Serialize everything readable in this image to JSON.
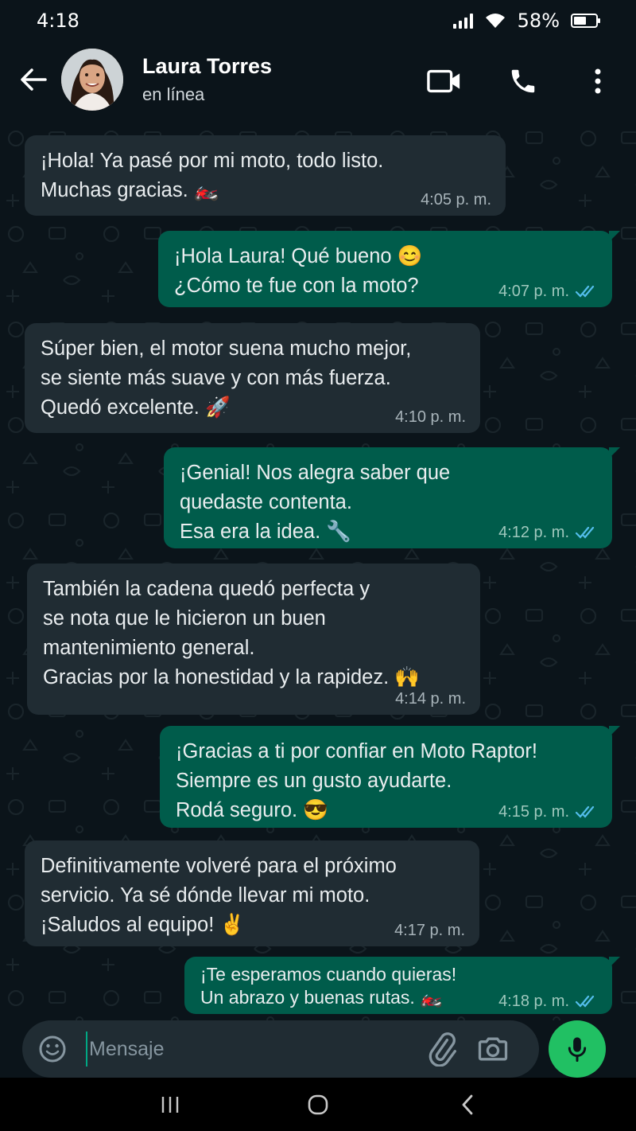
{
  "status_bar": {
    "time": "4:18",
    "battery": "58%",
    "battery_level": 0.58
  },
  "header": {
    "back_icon": "arrow-left-icon",
    "contact_name": "Laura Torres",
    "contact_status": "en línea",
    "video_icon": "video-call-icon",
    "call_icon": "phone-icon",
    "menu_icon": "more-vertical-icon"
  },
  "messages": [
    {
      "direction": "in",
      "text": "¡Hola! Ya pasé por mi moto, todo listo.\nMuchas gracias. 🏍️",
      "time": "4:05 p. m."
    },
    {
      "direction": "out",
      "text": "¡Hola Laura! Qué bueno 😊\n¿Cómo te fue con la moto?",
      "time": "4:07 p. m.",
      "read": true
    },
    {
      "direction": "in",
      "text": "Súper bien, el motor suena mucho mejor,\nse siente más suave y con más fuerza.\nQuedó excelente. 🚀",
      "time": "4:10 p. m."
    },
    {
      "direction": "out",
      "text": "¡Genial! Nos alegra saber que\nquedaste contenta.\nEsa era la idea. 🔧",
      "time": "4:12 p. m.",
      "read": true
    },
    {
      "direction": "in",
      "text": "También la cadena quedó perfecta y\nse nota que le hicieron un buen\nmantenimiento general.\nGracias por la honestidad y la rapidez. 🙌",
      "time": "4:14 p. m."
    },
    {
      "direction": "out",
      "text": "¡Gracias a ti por confiar en Moto Raptor!\nSiempre es un gusto ayudarte.\nRodá seguro. 😎",
      "time": "4:15 p. m.",
      "read": true
    },
    {
      "direction": "in",
      "text": "Definitivamente volveré para el próximo\nservicio. Ya sé dónde llevar mi moto.\n¡Saludos al equipo! ✌️",
      "time": "4:17 p. m."
    },
    {
      "direction": "out",
      "text": "¡Te esperamos cuando quieras!\nUn abrazo y buenas rutas. 🏍️",
      "time": "4:18 p. m.",
      "read": true
    }
  ],
  "composer": {
    "placeholder": "Mensaje",
    "emoji_icon": "emoji-icon",
    "attach_icon": "paperclip-icon",
    "camera_icon": "camera-icon",
    "mic_icon": "microphone-icon"
  },
  "nav": {
    "recents_icon": "recents-icon",
    "home_icon": "home-icon",
    "back_icon": "nav-back-icon"
  },
  "colors": {
    "background": "#0b141a",
    "incoming_bubble": "#202c33",
    "outgoing_bubble": "#005c4b",
    "read_ticks": "#53bdeb",
    "accent_green": "#21c063"
  }
}
